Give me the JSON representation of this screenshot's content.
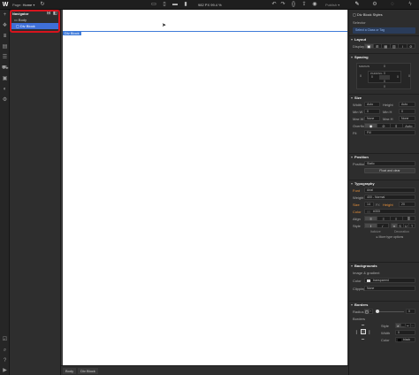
{
  "topbar": {
    "logo": "W",
    "page_label": "Page:",
    "page_name": "Home",
    "dims": "982 PX  99.4 %",
    "publish": "Publish"
  },
  "navigator": {
    "title": "Navigator",
    "items": [
      {
        "label": "Body"
      },
      {
        "label": "Div Block"
      }
    ]
  },
  "canvas": {
    "selected_tag": "Div Block"
  },
  "breadcrumbs": [
    "Body",
    "Div Block"
  ],
  "panel": {
    "selection_title": "Div Block Styles",
    "selector_label": "Selector",
    "selector_placeholder": "Select a Class or Tag",
    "layout": {
      "title": "Layout",
      "display_label": "Display"
    },
    "spacing": {
      "title": "Spacing",
      "margin_label": "MARGIN",
      "padding_label": "PADDING",
      "values": [
        "0",
        "0",
        "0",
        "0",
        "0",
        "0",
        "0",
        "0"
      ]
    },
    "size": {
      "title": "Size",
      "width_label": "Width",
      "width_val": "Auto",
      "height_label": "Height",
      "height_val": "Auto",
      "minw_label": "Min W",
      "minw_val": "0",
      "minh_label": "Min H",
      "minh_val": "0",
      "maxw_label": "Max W",
      "maxw_val": "None",
      "maxh_label": "Max H",
      "maxh_val": "None",
      "overflow_label": "Overflow",
      "overflow_auto": "Auto",
      "fit_label": "Fit",
      "fit_val": "Fill"
    },
    "position": {
      "title": "Position",
      "position_label": "Position",
      "position_val": "Static",
      "float_btn": "Float and clear"
    },
    "typography": {
      "title": "Typography",
      "font_label": "Font",
      "font_val": "Arial",
      "weight_label": "Weight",
      "weight_val": "400 - Normal",
      "size_label": "Size",
      "size_val": "14",
      "size_unit": "PX",
      "height_label": "Height",
      "height_val": "20",
      "color_label": "Color",
      "color_val": "#333",
      "align_label": "Align",
      "style_label": "Style",
      "italicize": "Italicize",
      "decoration": "Decoration",
      "more_btn": "More type options"
    },
    "backgrounds": {
      "title": "Backgrounds",
      "image_label": "Image & gradient",
      "color_label": "Color",
      "color_val": "transparent",
      "clipping_label": "Clipping",
      "clipping_val": "None"
    },
    "borders": {
      "title": "Borders",
      "radius_label": "Radius",
      "radius_val": "0",
      "borders_label": "Borders",
      "style_label": "Style",
      "width_label": "Width",
      "width_val": "0",
      "color_label": "Color",
      "color_val": "black"
    }
  },
  "colors": {
    "accent": "#3f6fd8",
    "highlight": "#d6141d",
    "orange_label": "#e8913a"
  }
}
